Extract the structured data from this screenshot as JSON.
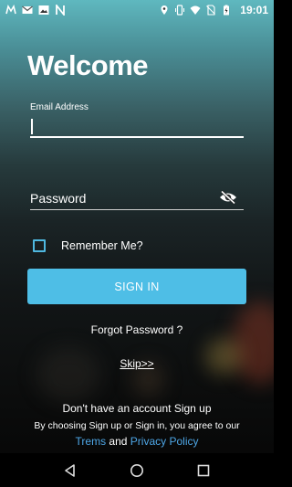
{
  "status_bar": {
    "time": "19:01",
    "left_icons": [
      "m-app-icon",
      "gmail-icon",
      "image-icon",
      "n-app-icon"
    ],
    "right_icons": [
      "location-icon",
      "vibrate-icon",
      "wifi-icon",
      "no-sim-icon",
      "battery-charging-icon"
    ]
  },
  "welcome": {
    "title": "Welcome"
  },
  "email": {
    "label": "Email Address",
    "value": ""
  },
  "password": {
    "placeholder": "Password",
    "value": "",
    "toggle_icon": "eye-off-icon"
  },
  "remember": {
    "label": "Remember Me?",
    "checked": false
  },
  "buttons": {
    "sign_in": "SIGN IN",
    "forgot_password": "Forgot Password ?",
    "skip": "Skip>>"
  },
  "footer": {
    "no_account": "Don't have an account Sign up",
    "agreement": "By choosing Sign up or Sign in, you agree to our",
    "terms_link": "Trems",
    "and": "and",
    "privacy_link": "Privacy Policy"
  },
  "colors": {
    "accent": "#4ebee6",
    "link": "#4ea6e6",
    "checkbox": "#4fb8e0"
  },
  "nav_bar": {
    "icons": [
      "back-icon",
      "home-icon",
      "recents-icon"
    ]
  }
}
